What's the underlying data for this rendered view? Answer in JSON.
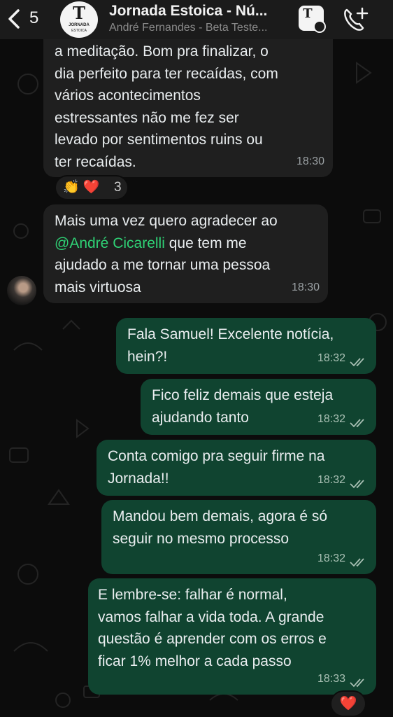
{
  "header": {
    "back_count": "5",
    "title": "Jornada Estoica - Nú...",
    "subtitle": "André Fernandes - Beta Teste...",
    "avatar_logo_letter": "T",
    "avatar_logo_name": "JORNADA",
    "avatar_logo_sub": "ESTOICA",
    "community_logo_letter": "T"
  },
  "messages": [
    {
      "direction": "in",
      "text": "a meditação. Bom pra finalizar, o\ndia perfeito para ter recaídas, com\nvários acontecimentos\nestressantes não me fez ser\nlevado por sentimentos ruins ou\nter recaídas.",
      "time": "18:30"
    },
    {
      "direction": "in",
      "text_before": "Mais uma vez quero agradecer ao\n",
      "mention": "@André Cicarelli",
      "text_after": " que tem me\najudado a me tornar uma pessoa\nmais virtuosa",
      "time": "18:30"
    },
    {
      "direction": "out",
      "text": "Fala Samuel! Excelente notícia,\nhein?!",
      "time": "18:32"
    },
    {
      "direction": "out",
      "text": "Fico feliz demais que esteja\najudando tanto",
      "time": "18:32"
    },
    {
      "direction": "out",
      "text": "Conta comigo pra seguir firme na\nJornada!!",
      "time": "18:32"
    },
    {
      "direction": "out",
      "text": "Mandou bem demais, agora é só\nseguir no mesmo processo",
      "time": "18:32"
    },
    {
      "direction": "out",
      "text": "E lembre-se: falhar é normal,\nvamos falhar a vida toda. A grande\nquestão é aprender com os erros e\nficar 1% melhor a cada passo",
      "time": "18:33"
    }
  ],
  "reactions": {
    "first": {
      "emojis": "👏 ❤️",
      "count": "3"
    },
    "last": {
      "emojis": "❤️"
    }
  },
  "colors": {
    "incoming_bubble": "#1f1f1f",
    "outgoing_bubble": "#104430",
    "mention": "#2fd175",
    "header": "#1b1b1b"
  },
  "icons": [
    "back-chevron-icon",
    "community-icon",
    "add-call-icon",
    "read-ticks-icon"
  ]
}
